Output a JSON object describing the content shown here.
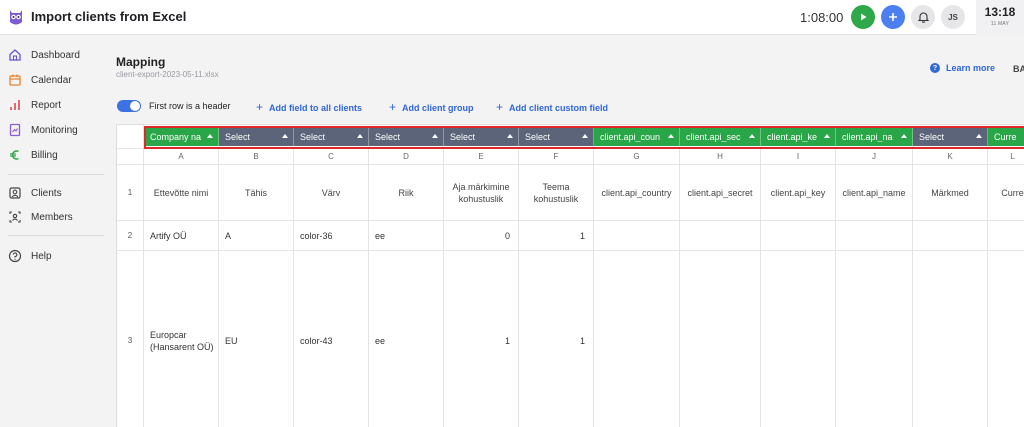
{
  "header": {
    "title": "Import clients from Excel",
    "timer": "1:08:00",
    "avatar_initials": "JS",
    "clock_time": "13:18",
    "clock_date": "11 MAY"
  },
  "sidebar": {
    "items": [
      {
        "label": "Dashboard",
        "icon": "home-icon"
      },
      {
        "label": "Calendar",
        "icon": "calendar-icon"
      },
      {
        "label": "Report",
        "icon": "bar-chart-icon"
      },
      {
        "label": "Monitoring",
        "icon": "monitoring-icon"
      },
      {
        "label": "Billing",
        "icon": "euro-icon"
      },
      {
        "label": "Clients",
        "icon": "clients-icon"
      },
      {
        "label": "Members",
        "icon": "members-icon"
      },
      {
        "label": "Help",
        "icon": "help-icon"
      }
    ]
  },
  "page": {
    "title": "Mapping",
    "file_name": "client-export-2023-05-11.xlsx",
    "learn_more": "Learn more",
    "back_partial": "BA",
    "toggle_label": "First row is a header",
    "actions": {
      "add_field": "Add field to all clients",
      "add_group": "Add client group",
      "add_custom": "Add client custom field"
    }
  },
  "table": {
    "mappings": [
      {
        "label": "Company na",
        "mapped": true
      },
      {
        "label": "Select",
        "mapped": false
      },
      {
        "label": "Select",
        "mapped": false
      },
      {
        "label": "Select",
        "mapped": false
      },
      {
        "label": "Select",
        "mapped": false
      },
      {
        "label": "Select",
        "mapped": false
      },
      {
        "label": "client.api_coun",
        "mapped": true
      },
      {
        "label": "client.api_sec",
        "mapped": true
      },
      {
        "label": "client.api_ke",
        "mapped": true
      },
      {
        "label": "client.api_na",
        "mapped": true
      },
      {
        "label": "Select",
        "mapped": false
      },
      {
        "label": "Curre",
        "mapped": true
      }
    ],
    "columns": [
      "A",
      "B",
      "C",
      "D",
      "E",
      "F",
      "G",
      "H",
      "I",
      "J",
      "K",
      "L"
    ],
    "headers": [
      "Ettevõtte nimi",
      "Tähis",
      "Värv",
      "Riik",
      "Aja märkimine kohustuslik",
      "Teema kohustuslik",
      "client.api_country",
      "client.api_secret",
      "client.api_key",
      "client.api_name",
      "Märkmed",
      "Curre"
    ],
    "rows": [
      {
        "num": "1"
      },
      {
        "num": "2",
        "cells": [
          "Artify OÜ",
          "A",
          "color-36",
          "ee",
          "0",
          "1",
          "",
          "",
          "",
          "",
          "",
          ""
        ]
      },
      {
        "num": "3",
        "cells": [
          "Europcar (Hansarent OÜ)",
          "EU",
          "color-43",
          "ee",
          "1",
          "1",
          "",
          "",
          "",
          "",
          "",
          ""
        ]
      }
    ]
  },
  "colors": {
    "accent": "#2f66d8",
    "mapped": "#29a648",
    "unmapped": "#5b6478",
    "highlight": "#e02828"
  }
}
